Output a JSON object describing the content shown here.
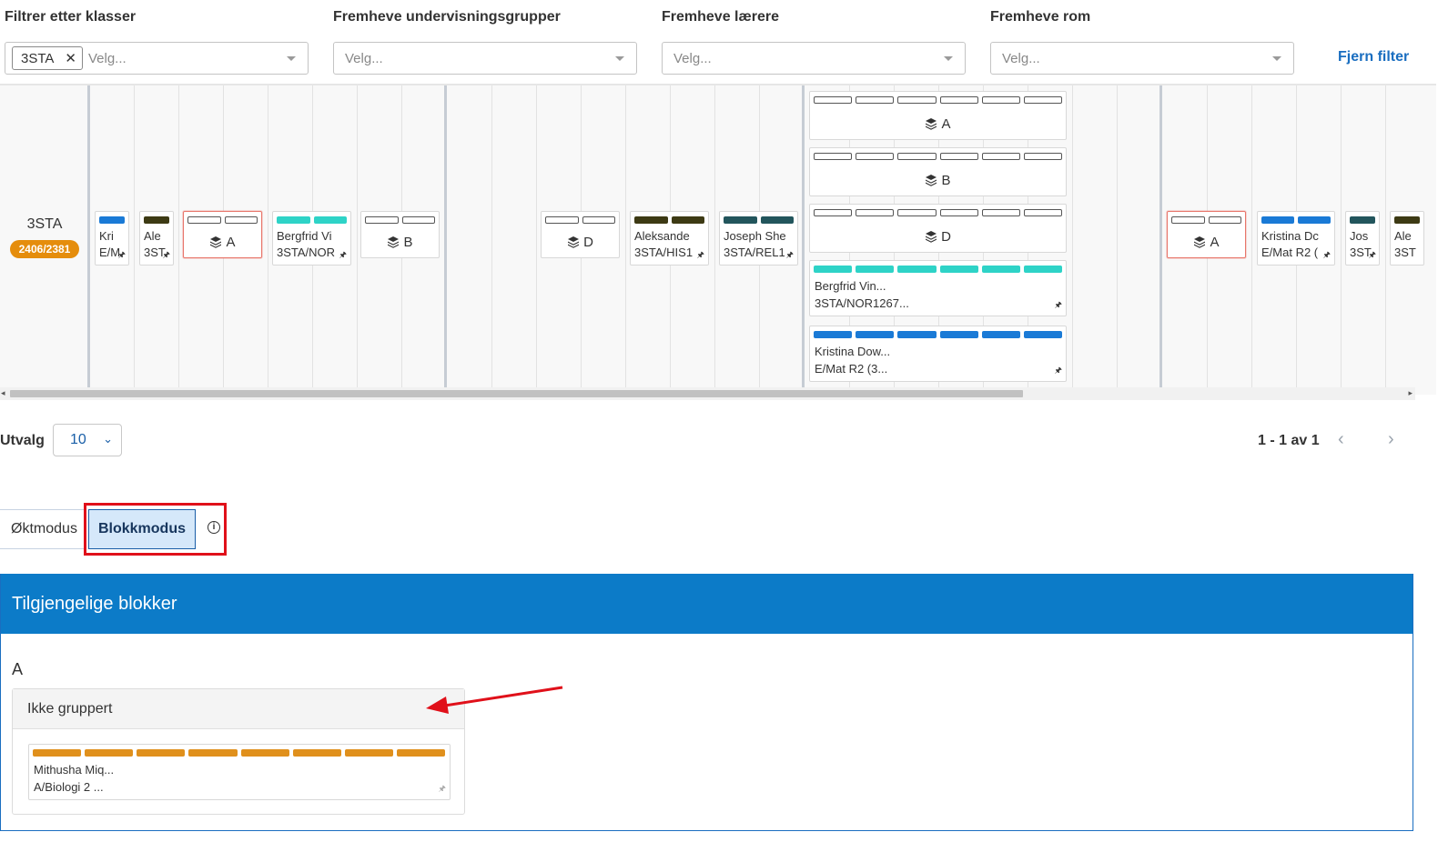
{
  "filters": {
    "klasser": {
      "label": "Filtrer etter klasser",
      "chip": "3STA",
      "chip_remove": "✕",
      "placeholder": "Velg..."
    },
    "grupper": {
      "label": "Fremheve undervisningsgrupper",
      "placeholder": "Velg..."
    },
    "laerere": {
      "label": "Fremheve lærere",
      "placeholder": "Velg..."
    },
    "rom": {
      "label": "Fremheve rom",
      "placeholder": "Velg..."
    },
    "clear_label": "Fjern filter"
  },
  "schedule": {
    "row_label": "3STA",
    "row_badge": "2406/2381",
    "pin_glyph": "🖈",
    "cards": [
      {
        "line1": "Kri",
        "line2": "E/M"
      },
      {
        "line1": "Ale",
        "line2": "3ST"
      },
      {
        "block": "A"
      },
      {
        "line1": "Bergfrid Vi",
        "line2": "3STA/NOR"
      },
      {
        "block": "B"
      },
      {
        "block": "D"
      },
      {
        "line1": "Aleksande",
        "line2": "3STA/HIS1"
      },
      {
        "line1": "Joseph She",
        "line2": "3STA/REL1"
      },
      {
        "block": "A"
      },
      {
        "line1": "Kristina Dc",
        "line2": "E/Mat R2 ("
      },
      {
        "line1": "Jos",
        "line2": "3ST"
      },
      {
        "line1": "Ale",
        "line2": "3ST"
      }
    ],
    "expanded": [
      {
        "block": "A"
      },
      {
        "block": "B"
      },
      {
        "block": "D"
      },
      {
        "line1": "Bergfrid Vin...",
        "line2": "3STA/NOR1267..."
      },
      {
        "line1": "Kristina Dow...",
        "line2": "E/Mat R2 (3..."
      }
    ],
    "colors": {
      "blue": "#1a7ad6",
      "olive": "#3d3a14",
      "teal": "#2ed3c7",
      "darkteal": "#22555c",
      "orange": "#e0901c"
    }
  },
  "pagination": {
    "label": "Utvalg",
    "page_size": "10",
    "range_text": "1 - 1 av 1",
    "prev": "‹",
    "next": "›"
  },
  "mode": {
    "okt_label": "Øktmodus",
    "blokk_label": "Blokkmodus",
    "info": "i"
  },
  "available": {
    "title": "Tilgjengelige blokker",
    "section": "A",
    "group_title": "Ikke gruppert",
    "card": {
      "line1": "Mithusha Miq...",
      "line2": "A/Biologi 2 ..."
    }
  }
}
